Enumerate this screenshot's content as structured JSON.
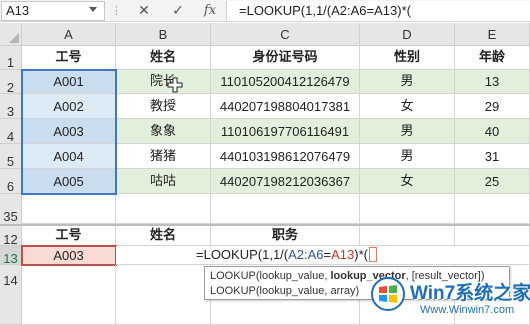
{
  "formula_bar": {
    "name_box": "A13",
    "cancel_icon": "✕",
    "enter_icon": "✓",
    "fx_label": "fx",
    "formula": "=LOOKUP(1,1/(A2:A6=A13)*("
  },
  "columns": [
    "A",
    "B",
    "C",
    "D",
    "E"
  ],
  "rows_visible": [
    "1",
    "2",
    "3",
    "4",
    "5",
    "6",
    "35",
    "12",
    "13",
    "14"
  ],
  "table_header": {
    "id": "工号",
    "name": "姓名",
    "idcard": "身份证号码",
    "gender": "性别",
    "age": "年龄"
  },
  "table_rows": [
    {
      "id": "A001",
      "name": "院长",
      "idcard": "110105200412126479",
      "gender": "男",
      "age": "13"
    },
    {
      "id": "A002",
      "name": "教授",
      "idcard": "440207198804017381",
      "gender": "女",
      "age": "29"
    },
    {
      "id": "A003",
      "name": "象象",
      "idcard": "110106197706116491",
      "gender": "男",
      "age": "40"
    },
    {
      "id": "A004",
      "name": "猪猪",
      "idcard": "440103198612076479",
      "gender": "男",
      "age": "31"
    },
    {
      "id": "A005",
      "name": "咕咕",
      "idcard": "440207198212036367",
      "gender": "女",
      "age": "25"
    }
  ],
  "lookup_header": {
    "id": "工号",
    "name": "姓名",
    "title": "职务"
  },
  "lookup_row": {
    "id": "A003"
  },
  "cell_edit": {
    "prefix": "=LOOKUP(1,1/(",
    "ref1": "A2:A6",
    "eq": "=",
    "ref2": "A13",
    "suffix": ")*("
  },
  "tooltip": {
    "line1_a": "LOOKUP(lookup_value, ",
    "line1_b": "lookup_vector",
    "line1_c": ", [result_vector])",
    "line2": "LOOKUP(lookup_value, array)"
  },
  "watermark": {
    "title": "Win7系统之家",
    "url": "Www.Winwin7.com"
  },
  "colors": {
    "accent": "#217346",
    "row_green": "#e2efda",
    "row_blue": "#ddebf7",
    "edit_row": "#f8dcd3",
    "ref_blue": "#4472c4",
    "ref_red": "#c0504d"
  }
}
